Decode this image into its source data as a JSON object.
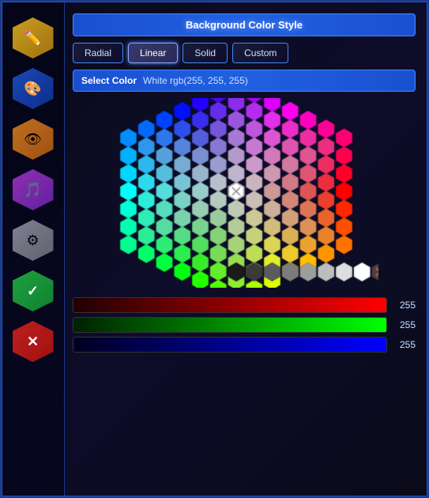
{
  "panel": {
    "title": "Background Color Style",
    "style_buttons": [
      {
        "label": "Radial",
        "active": false
      },
      {
        "label": "Linear",
        "active": true
      },
      {
        "label": "Solid",
        "active": false
      },
      {
        "label": "Custom",
        "active": false
      }
    ],
    "select_color_label": "Select Color",
    "select_color_value": "White  rgb(255, 255, 255)"
  },
  "sidebar": {
    "buttons": [
      {
        "icon": "✏️",
        "style": "yellow",
        "name": "edit"
      },
      {
        "icon": "🎨",
        "style": "blue",
        "name": "palette"
      },
      {
        "icon": "👁",
        "style": "orange",
        "name": "eye"
      },
      {
        "icon": "🎵",
        "style": "purple",
        "name": "music"
      },
      {
        "icon": "⚙",
        "style": "gray",
        "name": "settings"
      },
      {
        "icon": "✓",
        "style": "green",
        "name": "confirm"
      },
      {
        "icon": "✕",
        "style": "red",
        "name": "cancel"
      }
    ]
  },
  "sliders": {
    "red": {
      "value": 255,
      "label": "255"
    },
    "green": {
      "value": 255,
      "label": "255"
    },
    "blue": {
      "value": 255,
      "label": "255"
    }
  }
}
